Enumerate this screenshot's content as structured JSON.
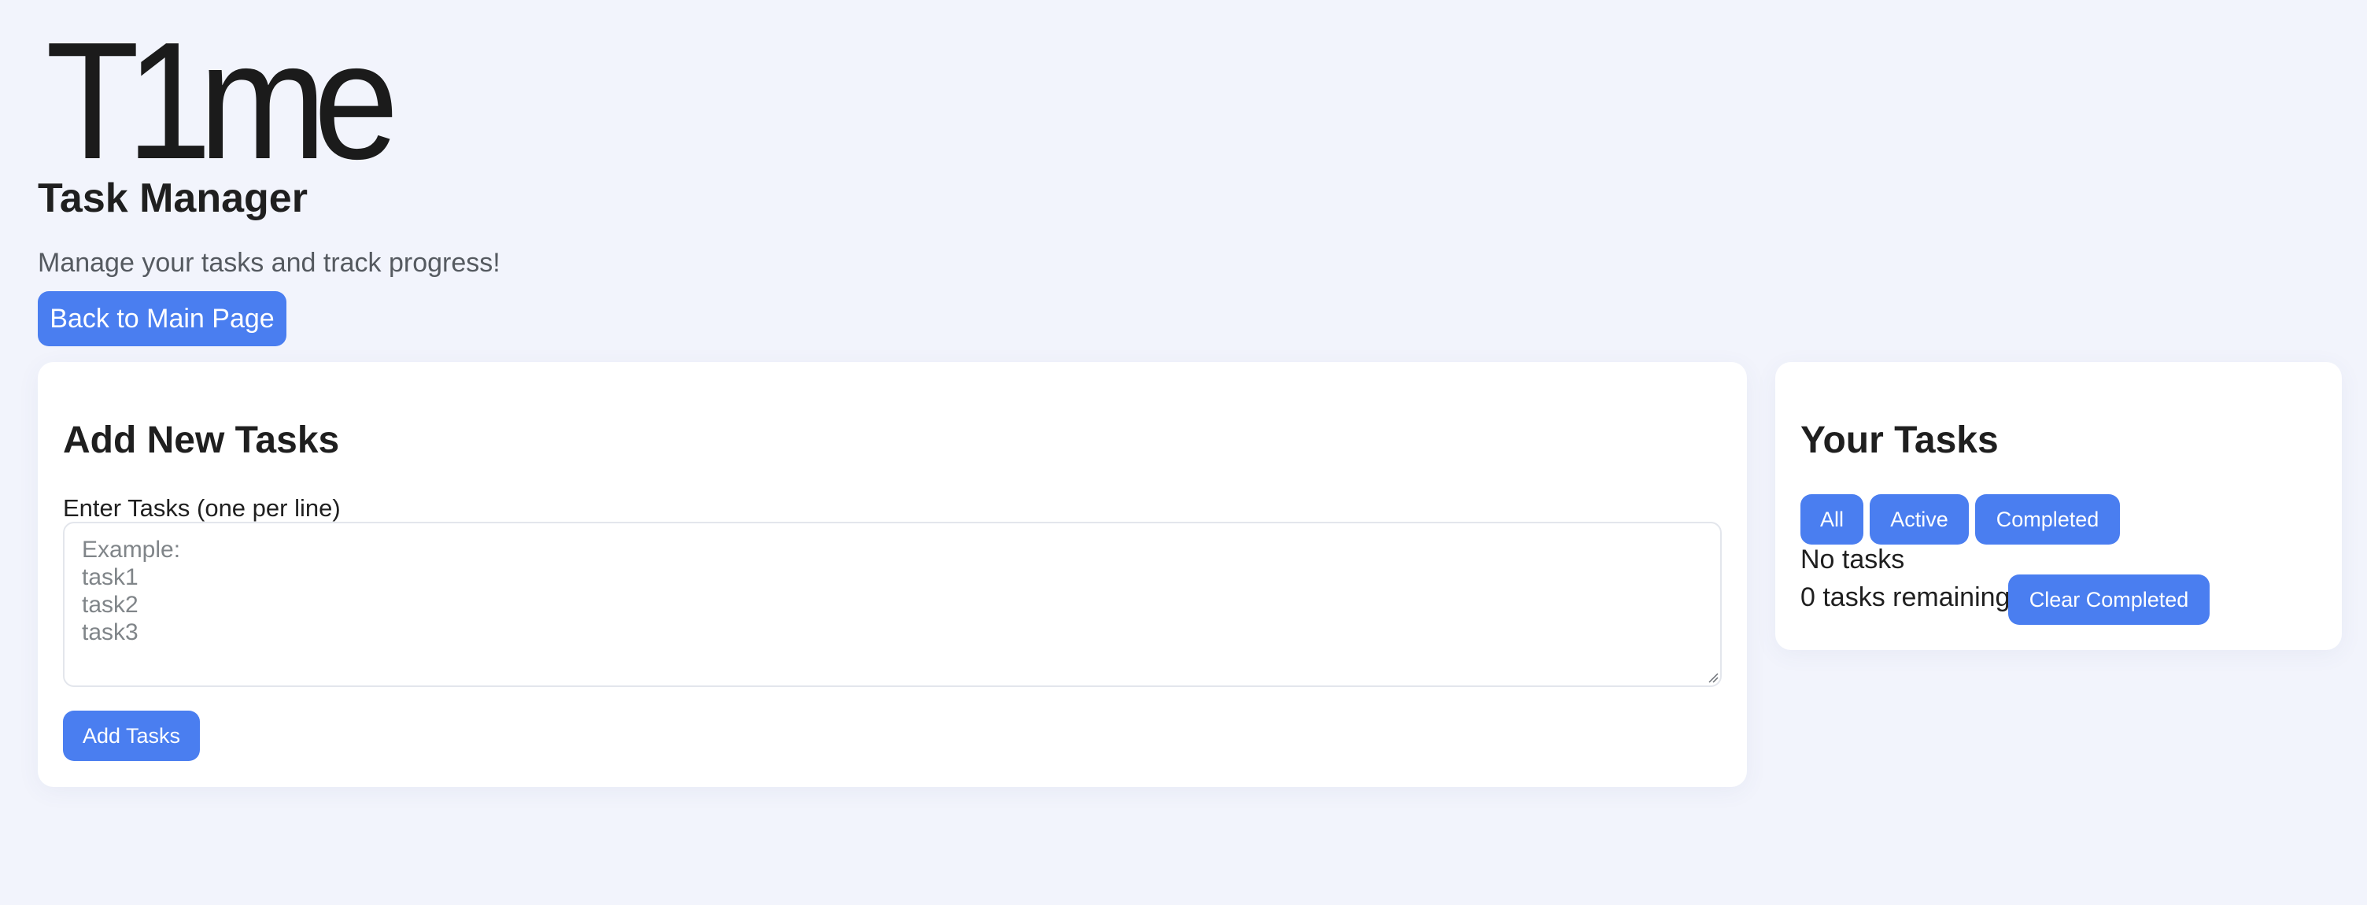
{
  "app": {
    "logo_text": "T1me",
    "title": "Task Manager",
    "subtitle": "Manage your tasks and track progress!",
    "back_button_label": "Back to Main Page"
  },
  "add_tasks_panel": {
    "heading": "Add New Tasks",
    "field_label": "Enter Tasks (one per line)",
    "field_value": "",
    "field_placeholder": "Example:\ntask1\ntask2\ntask3",
    "submit_label": "Add Tasks"
  },
  "tasks_panel": {
    "heading": "Your Tasks",
    "filters": [
      {
        "label": "All"
      },
      {
        "label": "Active"
      },
      {
        "label": "Completed"
      }
    ],
    "empty_text": "No tasks",
    "remaining_text": "0 tasks remaining",
    "clear_label": "Clear Completed"
  },
  "colors": {
    "accent": "#4a7ef0",
    "background": "#f2f4fc",
    "card": "#ffffff"
  }
}
